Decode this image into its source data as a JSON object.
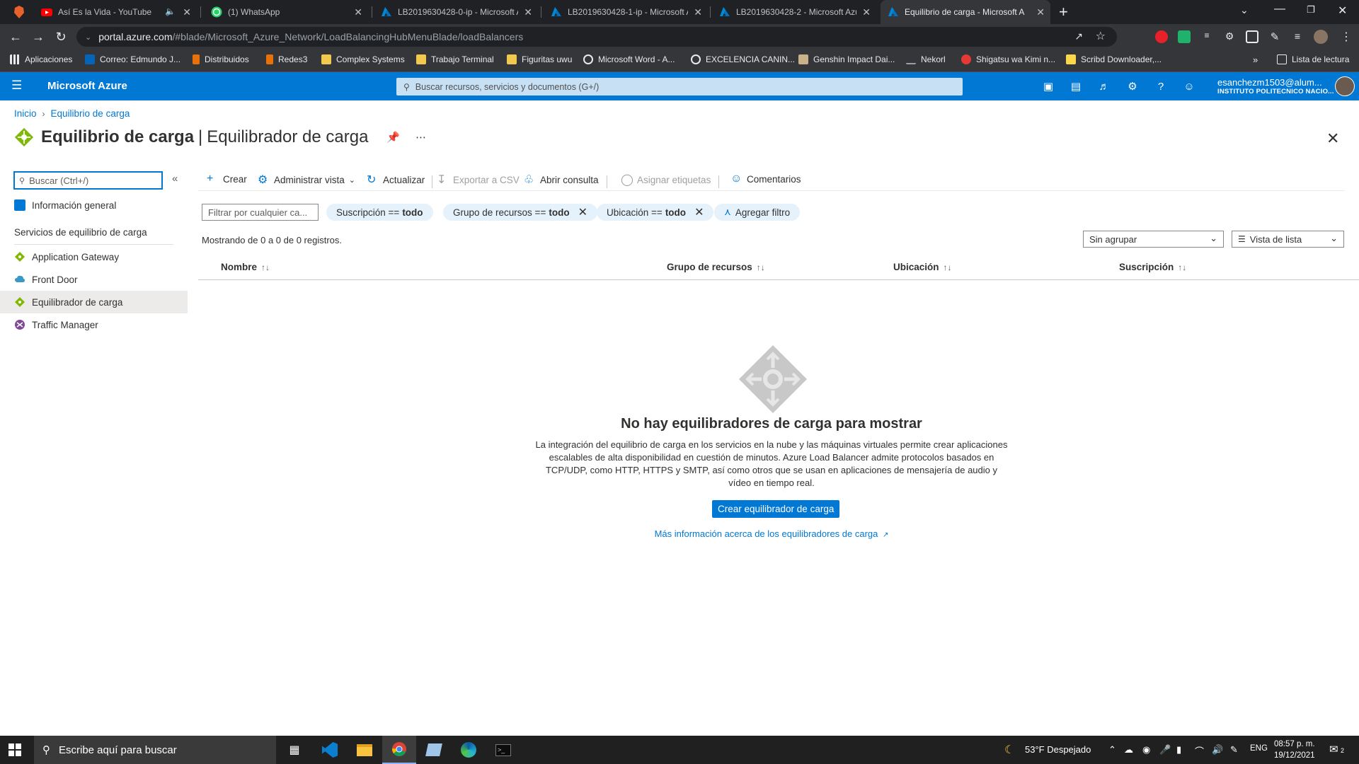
{
  "browser": {
    "tabs": [
      {
        "title": "Así Es la Vida - YouTube",
        "icon": "youtube-icon",
        "color": "#ff0000"
      },
      {
        "title": "(1) WhatsApp",
        "icon": "whatsapp-icon",
        "color": "#25d366"
      },
      {
        "title": "LB2019630428-0-ip - Microsoft A",
        "icon": "azure-icon",
        "color": "#0089d6"
      },
      {
        "title": "LB2019630428-1-ip - Microsoft A",
        "icon": "azure-icon",
        "color": "#0089d6"
      },
      {
        "title": "LB2019630428-2 - Microsoft Azu",
        "icon": "azure-icon",
        "color": "#0089d6"
      },
      {
        "title": "Equilibrio de carga - Microsoft A",
        "icon": "azure-icon",
        "color": "#0089d6"
      }
    ],
    "url_host": "portal.azure.com",
    "url_path": "/#blade/Microsoft_Azure_Network/LoadBalancingHubMenuBlade/loadBalancers",
    "bookmarks": [
      {
        "label": "Aplicaciones"
      },
      {
        "label": "Correo: Edmundo J..."
      },
      {
        "label": "Distribuidos"
      },
      {
        "label": "Redes3"
      },
      {
        "label": "Complex Systems"
      },
      {
        "label": "Trabajo Terminal"
      },
      {
        "label": "Figuritas uwu"
      },
      {
        "label": "Microsoft Word - A..."
      },
      {
        "label": "EXCELENCIA CANIN..."
      },
      {
        "label": "Genshin Impact Dai..."
      },
      {
        "label": "Nekorl"
      },
      {
        "label": "Shigatsu wa Kimi n..."
      },
      {
        "label": "Scribd Downloader,..."
      }
    ],
    "reading_list": "Lista de lectura"
  },
  "azure": {
    "brand": "Microsoft Azure",
    "search_placeholder": "Buscar recursos, servicios y documentos (G+/)",
    "user_email": "esanchezm1503@alum...",
    "user_org": "INSTITUTO POLITECNICO NACIO...",
    "brand_color": "#0078d4"
  },
  "page": {
    "breadcrumb": [
      "Inicio",
      "Equilibrio de carga"
    ],
    "title": "Equilibrio de carga",
    "subtitle": "Equilibrador de carga"
  },
  "menu": {
    "search_placeholder": "Buscar (Ctrl+/)",
    "overview": "Información general",
    "section_header": "Servicios de equilibrio de carga",
    "items": [
      {
        "label": "Application Gateway"
      },
      {
        "label": "Front Door"
      },
      {
        "label": "Equilibrador de carga"
      },
      {
        "label": "Traffic Manager"
      }
    ]
  },
  "toolbar": {
    "create": "Crear",
    "manage_view": "Administrar vista",
    "refresh": "Actualizar",
    "export_csv": "Exportar a CSV",
    "open_query": "Abrir consulta",
    "assign_tags": "Asignar etiquetas",
    "feedback": "Comentarios"
  },
  "filters": {
    "placeholder": "Filtrar por cualquier ca...",
    "subscription_label": "Suscripción ==",
    "subscription_value": "todo",
    "resource_group_label": "Grupo de recursos ==",
    "resource_group_value": "todo",
    "location_label": "Ubicación ==",
    "location_value": "todo",
    "add_filter": "Agregar filtro"
  },
  "list": {
    "count_text": "Mostrando de 0 a 0 de 0 registros.",
    "grouping": "Sin agrupar",
    "view": "Vista de lista",
    "columns": [
      "Nombre",
      "Grupo de recursos",
      "Ubicación",
      "Suscripción"
    ]
  },
  "empty": {
    "title": "No hay equilibradores de carga para mostrar",
    "description": "La integración del equilibrio de carga en los servicios en la nube y las máquinas virtuales permite crear aplicaciones escalables de alta disponibilidad en cuestión de minutos. Azure Load Balancer admite protocolos basados en TCP/UDP, como HTTP, HTTPS y SMTP, así como otros que se usan en aplicaciones de mensajería de audio y vídeo en tiempo real.",
    "create_button": "Crear equilibrador de carga",
    "learn_more": "Más información acerca de los equilibradores de carga"
  },
  "taskbar": {
    "search_placeholder": "Escribe aquí para buscar",
    "weather": "53°F  Despejado",
    "language": "ENG",
    "time": "08:57 p. m.",
    "date": "19/12/2021",
    "notifications": "2"
  }
}
